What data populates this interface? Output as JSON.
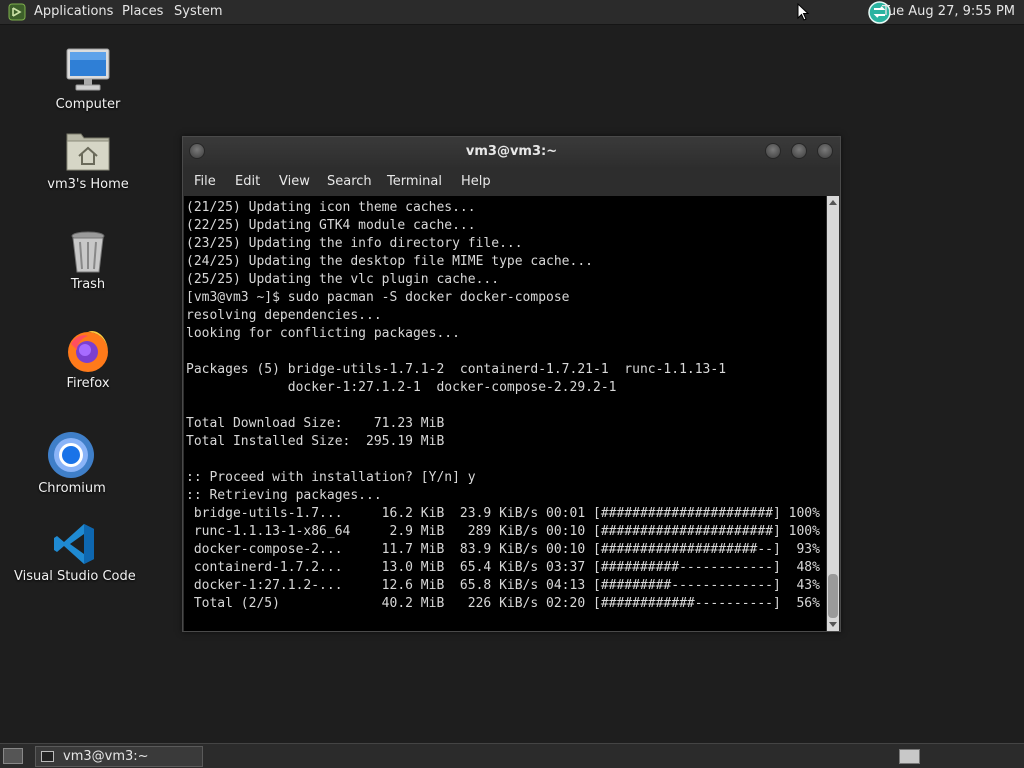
{
  "top_panel": {
    "menus": [
      "Applications",
      "Places",
      "System"
    ],
    "clock": "Tue Aug 27,  9:55 PM"
  },
  "desktop_icons": [
    {
      "label": "Computer",
      "icon": "computer-icon"
    },
    {
      "label": "vm3's Home",
      "icon": "home-folder-icon"
    },
    {
      "label": "Trash",
      "icon": "trash-icon"
    },
    {
      "label": "Firefox",
      "icon": "firefox-icon"
    },
    {
      "label": "Chromium",
      "icon": "chromium-icon"
    },
    {
      "label": "Visual Studio Code",
      "icon": "vscode-icon"
    }
  ],
  "terminal": {
    "title": "vm3@vm3:~",
    "menu": [
      "File",
      "Edit",
      "View",
      "Search",
      "Terminal",
      "Help"
    ],
    "lines": [
      "(21/25) Updating icon theme caches...",
      "(22/25) Updating GTK4 module cache...",
      "(23/25) Updating the info directory file...",
      "(24/25) Updating the desktop file MIME type cache...",
      "(25/25) Updating the vlc plugin cache...",
      "[vm3@vm3 ~]$ sudo pacman -S docker docker-compose",
      "resolving dependencies...",
      "looking for conflicting packages...",
      "",
      "Packages (5) bridge-utils-1.7.1-2  containerd-1.7.21-1  runc-1.1.13-1",
      "             docker-1:27.1.2-1  docker-compose-2.29.2-1",
      "",
      "Total Download Size:    71.23 MiB",
      "Total Installed Size:  295.19 MiB",
      "",
      ":: Proceed with installation? [Y/n] y",
      ":: Retrieving packages...",
      " bridge-utils-1.7...     16.2 KiB  23.9 KiB/s 00:01 [######################] 100%",
      " runc-1.1.13-1-x86_64     2.9 MiB   289 KiB/s 00:10 [######################] 100%",
      " docker-compose-2...     11.7 MiB  83.9 KiB/s 00:10 [####################--]  93%",
      " containerd-1.7.2...     13.0 MiB  65.4 KiB/s 03:37 [##########------------]  48%",
      " docker-1:27.1.2-...     12.6 MiB  65.8 KiB/s 04:13 [#########-------------]  43%",
      " Total (2/5)             40.2 MiB   226 KiB/s 02:20 [############----------]  56%"
    ]
  },
  "taskbar": {
    "window_label": "vm3@vm3:~"
  }
}
